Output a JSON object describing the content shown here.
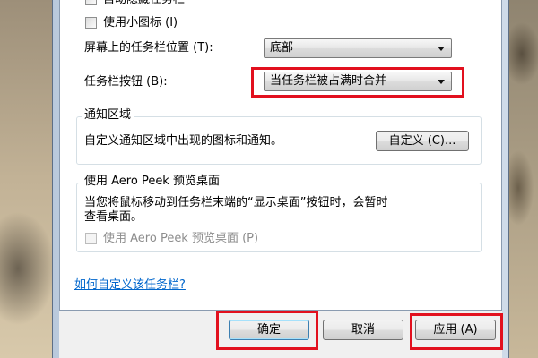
{
  "taskbar_props": {
    "auto_hide_label": "自动隐藏任务栏",
    "small_icons_label": "使用小图标 (I)",
    "location_label": "屏幕上的任务栏位置 (T):",
    "location_value": "底部",
    "buttons_label": "任务栏按钮 (B):",
    "buttons_value": "当任务栏被占满时合并"
  },
  "notification_area": {
    "title": "通知区域",
    "description": "自定义通知区域中出现的图标和通知。",
    "customize_button": "自定义 (C)..."
  },
  "aero_peek": {
    "title": "使用 Aero Peek 预览桌面",
    "description_line1": "当您将鼠标移动到任务栏末端的“显示桌面”按钮时，会暂时",
    "description_line2": "查看桌面。",
    "checkbox_label": "使用 Aero Peek 预览桌面 (P)"
  },
  "help_link": "如何自定义该任务栏?",
  "buttons": {
    "ok": "确定",
    "cancel": "取消",
    "apply": "应用 (A)"
  },
  "colors": {
    "highlight": "#e2101e",
    "link": "#0066cc"
  }
}
